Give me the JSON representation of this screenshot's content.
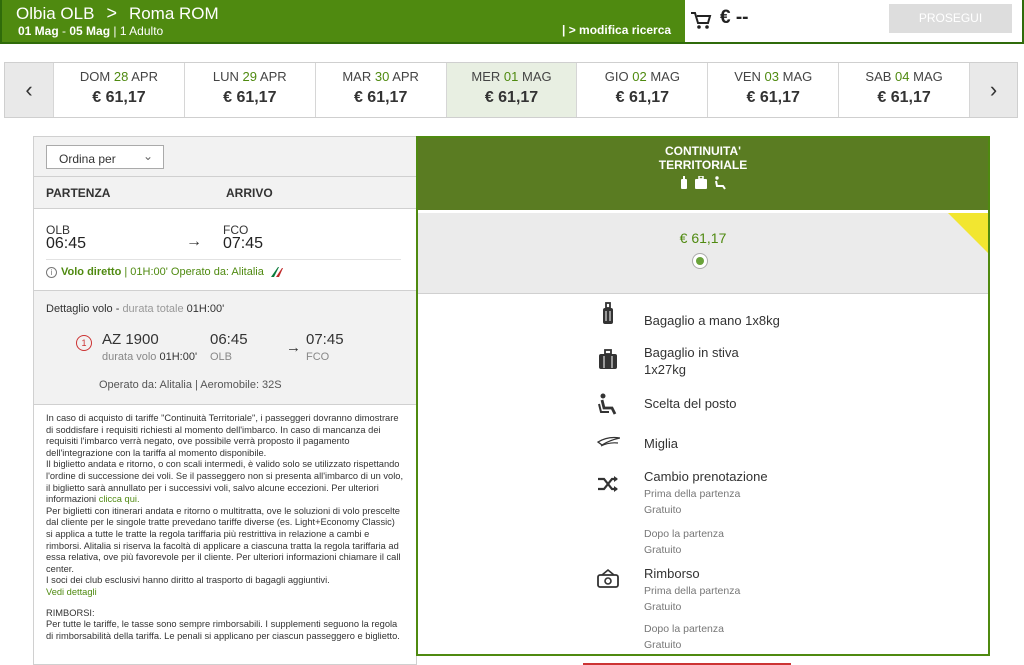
{
  "header": {
    "origin": "Olbia OLB",
    "arrow": ">",
    "destination": "Roma ROM",
    "dates_start": "01 Mag",
    "dates_sep": " - ",
    "dates_end": "05 Mag",
    "passengers": " | 1 Adulto",
    "modifica": "| > modifica ricerca",
    "cart_price": "€ --",
    "prosegui": "PROSEGUI"
  },
  "datebar": {
    "prev_icon": "chevron-left-icon",
    "next_icon": "chevron-right-icon",
    "days": [
      {
        "dow": "DOM",
        "num": "28",
        "mon": "APR",
        "price": "€ 61,17"
      },
      {
        "dow": "LUN",
        "num": "29",
        "mon": "APR",
        "price": "€ 61,17"
      },
      {
        "dow": "MAR",
        "num": "30",
        "mon": "APR",
        "price": "€ 61,17"
      },
      {
        "dow": "MER",
        "num": "01",
        "mon": "MAG",
        "price": "€ 61,17"
      },
      {
        "dow": "GIO",
        "num": "02",
        "mon": "MAG",
        "price": "€ 61,17"
      },
      {
        "dow": "VEN",
        "num": "03",
        "mon": "MAG",
        "price": "€ 61,17"
      },
      {
        "dow": "SAB",
        "num": "04",
        "mon": "MAG",
        "price": "€ 61,17"
      }
    ]
  },
  "sort": {
    "label": "Ordina per"
  },
  "columns": {
    "partenza": "PARTENZA",
    "arrivo": "ARRIVO"
  },
  "flight": {
    "from_code": "OLB",
    "from_time": "06:45",
    "to_code": "FCO",
    "to_time": "07:45",
    "direct_label": "Volo diretto",
    "direct_rest": " | 01H:00' Operato da: Alitalia"
  },
  "detail": {
    "title": "Dettaglio volo - ",
    "dur_label": "durata totale ",
    "dur_value": "01H:00'",
    "seg_num": "1",
    "flight_no": "AZ 1900",
    "dur_volo_label": "durata volo ",
    "dur_volo_value": "01H:00'",
    "dep_time": "06:45",
    "dep_code": "OLB",
    "arr_time": "07:45",
    "arr_code": "FCO",
    "operato": "Operato da: Alitalia | Aeromobile: 32S"
  },
  "terms": {
    "p1": "In caso di acquisto di tariffe \"Continuità Territoriale\", i passeggeri dovranno dimostrare di soddisfare i requisiti richiesti al momento dell'imbarco. In caso di mancanza dei requisiti l'imbarco verrà negato, ove possibile verrà proposto il pagamento dell'integrazione con la tariffa al momento disponibile.",
    "p2": "Il biglietto andata e ritorno, o con scali intermedi, è valido solo se utilizzato rispettando l'ordine di successione dei voli. Se il passeggero non si presenta all'imbarco di un volo, il biglietto sarà annullato per i successivi voli, salvo alcune eccezioni. Per ulteriori informazioni ",
    "p2_link": "clicca qui.",
    "p3": "Per biglietti con itinerari andata e ritorno o multitratta, ove le soluzioni di volo prescelte dal cliente per le singole tratte prevedano tariffe diverse (es. Light+Economy Classic) si applica a tutte le tratte la regola tariffaria più restrittiva in relazione a cambi e rimborsi.  Alitalia si riserva la facoltà di applicare a ciascuna tratta la regola tariffaria ad essa relativa, ove più favorevole per il cliente. Per ulteriori informazioni chiamare il call center.",
    "p4": "I soci dei club esclusivi hanno diritto al trasporto di bagagli aggiuntivi.",
    "p4_link": "Vedi dettagli",
    "rimb_title": "RIMBORSI:",
    "rimb_text": "Per tutte le tariffe, le tasse sono sempre rimborsabili. I supplementi seguono la regola di rimborsabilità della tariffa. Le penali si applicano per ciascun passeggero e biglietto."
  },
  "fare": {
    "name_line1": "CONTINUITA'",
    "name_line2": "TERRITORIALE",
    "price": "€ 61,17",
    "accent": "#5a7c22",
    "features": [
      {
        "icon": "carry-on-bag-icon",
        "label": "Bagaglio a mano 1x8kg"
      },
      {
        "icon": "checked-bag-icon",
        "label": "Bagaglio in stiva",
        "label2": "1x27kg"
      },
      {
        "icon": "seat-icon",
        "label": "Scelta del posto"
      },
      {
        "icon": "miles-wing-icon",
        "label": "Miglia"
      },
      {
        "icon": "shuffle-icon",
        "label": "Cambio prenotazione",
        "sub1": "Prima della partenza",
        "sub1v": "Gratuito",
        "sub2": "Dopo la partenza",
        "sub2v": "Gratuito"
      },
      {
        "icon": "refund-icon",
        "label": "Rimborso",
        "sub1": "Prima della partenza",
        "sub1v": "Gratuito",
        "sub2": "Dopo la partenza",
        "sub2v": "Gratuito"
      }
    ]
  }
}
